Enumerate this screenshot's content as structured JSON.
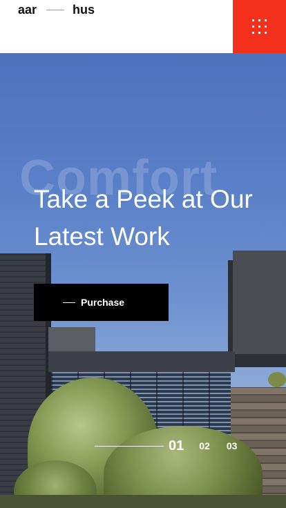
{
  "header": {
    "logo_left": "aar",
    "logo_right": "hus",
    "menu_icon": "grid-dots-icon",
    "accent_color": "#f2301c"
  },
  "hero": {
    "background_word": "Comfort",
    "headline_line1": "Take a Peek at Our",
    "headline_line2": "Latest Work",
    "cta_label": "Purchase"
  },
  "slider": {
    "slides": [
      "01",
      "02",
      "03"
    ],
    "active": "01"
  }
}
